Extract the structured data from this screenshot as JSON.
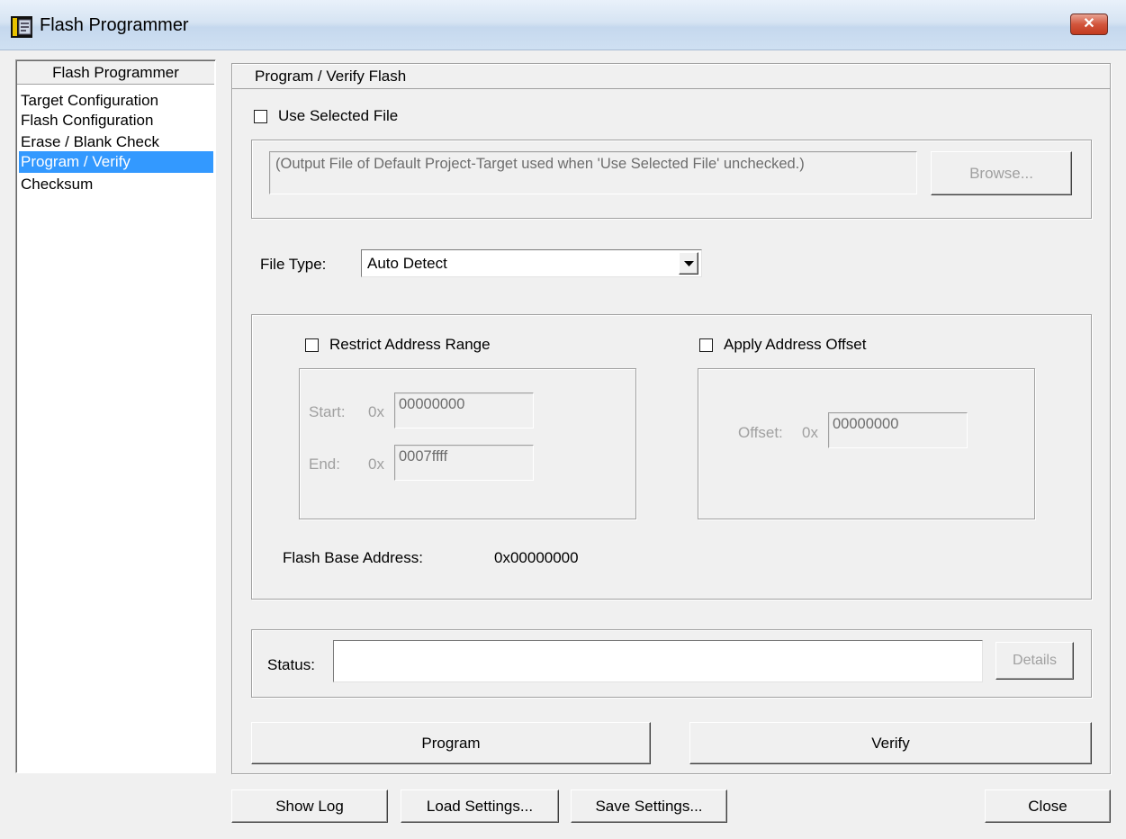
{
  "window": {
    "title": "Flash Programmer",
    "close_label": "✕"
  },
  "nav": {
    "header": "Flash Programmer",
    "items": [
      {
        "label": "Target Configuration",
        "selected": false
      },
      {
        "label": "Flash Configuration",
        "selected": false
      },
      {
        "label": "Erase / Blank Check",
        "selected": false
      },
      {
        "label": "Program / Verify",
        "selected": true
      },
      {
        "label": "Checksum",
        "selected": false
      }
    ]
  },
  "main": {
    "title": "Program / Verify Flash",
    "use_selected_file": {
      "label": "Use Selected File",
      "checked": false
    },
    "file_path": "(Output File of Default Project-Target used when 'Use Selected File' unchecked.)",
    "browse_label": "Browse...",
    "file_type": {
      "label": "File Type:",
      "value": "Auto Detect"
    },
    "restrict_range": {
      "label": "Restrict Address Range",
      "checked": false,
      "start_label": "Start:",
      "start_prefix": "0x",
      "start_value": "00000000",
      "end_label": "End:",
      "end_prefix": "0x",
      "end_value": "0007ffff"
    },
    "apply_offset": {
      "label": "Apply Address Offset",
      "checked": false,
      "offset_label": "Offset:",
      "offset_prefix": "0x",
      "offset_value": "00000000"
    },
    "flash_base": {
      "label": "Flash Base Address:",
      "value": "0x00000000"
    },
    "status": {
      "label": "Status:",
      "value": "",
      "details_label": "Details"
    },
    "program_label": "Program",
    "verify_label": "Verify"
  },
  "footer": {
    "show_log": "Show Log",
    "load_settings": "Load Settings...",
    "save_settings": "Save Settings...",
    "close": "Close"
  },
  "colors": {
    "selection": "#3399ff",
    "dialog_bg": "#f0f0f0",
    "disabled_text": "#a0a0a0"
  }
}
